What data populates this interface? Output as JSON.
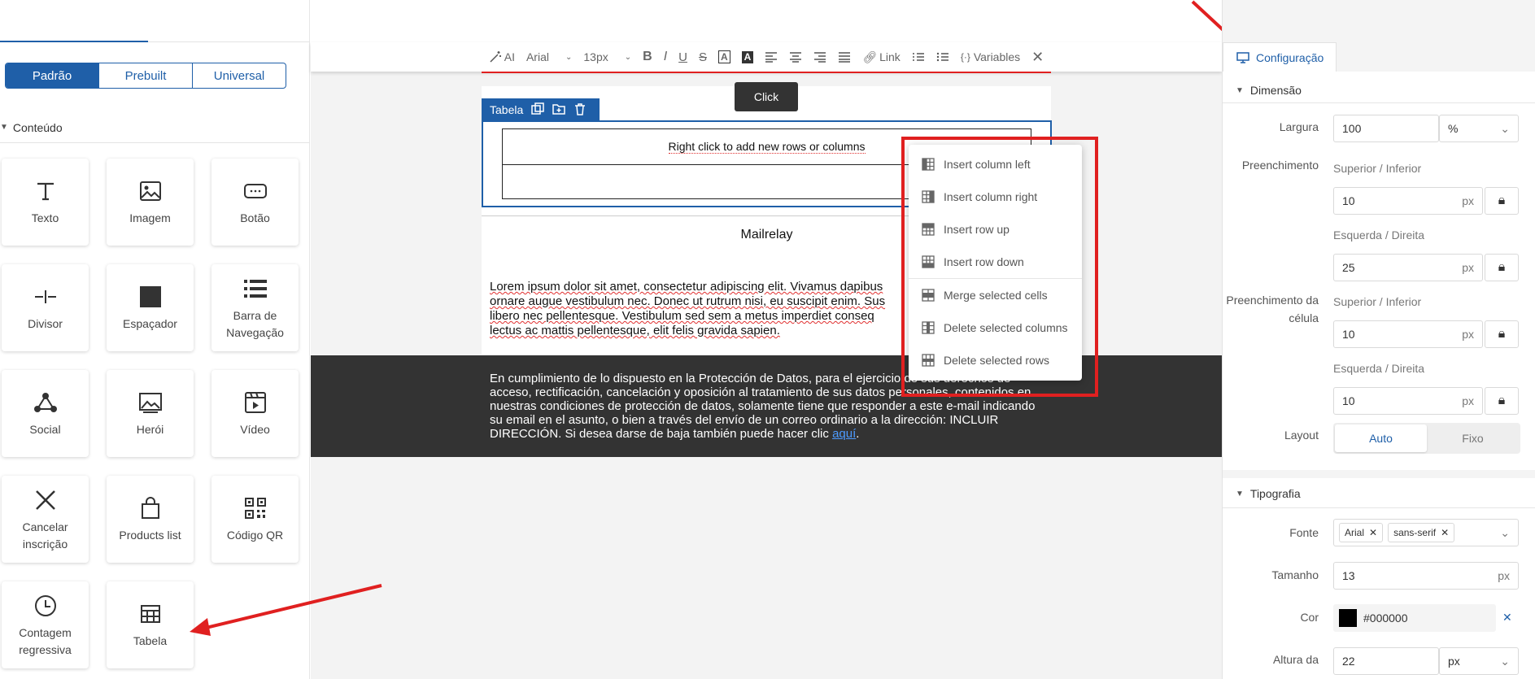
{
  "left": {
    "segments": [
      "Padrão",
      "Prebuilt",
      "Universal"
    ],
    "active_segment": "Padrão",
    "section_title": "Conteúdo",
    "blocks": [
      {
        "label": "Texto",
        "icon": "text-icon"
      },
      {
        "label": "Imagem",
        "icon": "image-icon"
      },
      {
        "label": "Botão",
        "icon": "button-icon"
      },
      {
        "label": "Divisor",
        "icon": "divider-icon"
      },
      {
        "label": "Espaçador",
        "icon": "spacer-icon"
      },
      {
        "label": "Barra de Navegação",
        "icon": "navbar-icon"
      },
      {
        "label": "Social",
        "icon": "social-icon"
      },
      {
        "label": "Herói",
        "icon": "hero-icon"
      },
      {
        "label": "Vídeo",
        "icon": "video-icon"
      },
      {
        "label": "Cancelar inscrição",
        "icon": "unsubscribe-icon"
      },
      {
        "label": "Products list",
        "icon": "shopping-bag-icon"
      },
      {
        "label": "Código QR",
        "icon": "qr-code-icon"
      },
      {
        "label": "Contagem regressiva",
        "icon": "clock-icon"
      },
      {
        "label": "Tabela",
        "icon": "table-icon"
      }
    ]
  },
  "toolbar": {
    "ai_label": "AI",
    "font": "Arial",
    "size": "13px",
    "link_label": "Link",
    "variables_label": "Variables"
  },
  "canvas": {
    "click_tip": "Click",
    "table_label": "Tabela",
    "table_hint": "Right click to add new rows or columns",
    "brand": "Mailrelay",
    "lorem_lines": [
      "Lorem ipsum dolor sit amet, consectetur adipiscing elit. Vivamus dapibus",
      "ornare augue vestibulum nec. Donec ut rutrum nisi, eu suscipit enim. Sus",
      "libero nec pellentesque. Vestibulum sed sem a metus imperdiet conseq",
      "lectus ac mattis pellentesque, elit felis gravida sapien."
    ],
    "legal_text": "En cumplimiento de lo dispuesto en la Protección de Datos, para el ejercicio de sus derechos de acceso, rectificación, cancelación y oposición al tratamiento de sus datos personales, contenidos en nuestras condiciones de protección de datos, solamente tiene que responder a este e-mail indicando su email en el asunto, o bien a través del envío de un correo ordinario a la dirección: INCLUIR DIRECCIÓN. Si desea darse de baja también puede hacer clic",
    "legal_link": "aquí",
    "legal_end": "."
  },
  "context_menu": {
    "items": [
      "Insert column left",
      "Insert column right",
      "Insert row up",
      "Insert row down",
      "Merge selected cells",
      "Delete selected columns",
      "Delete selected rows"
    ]
  },
  "right": {
    "tab_label": "Configuração",
    "dimension_title": "Dimensão",
    "largura_label": "Largura",
    "largura_value": "100",
    "largura_unit": "%",
    "preenchimento_label": "Preenchimento",
    "sup_inf": "Superior / Inferior",
    "esq_dir": "Esquerda / Direita",
    "pad_v": "10",
    "pad_h": "25",
    "cell_pad_label": "Preenchimento da célula",
    "cell_pad_v": "10",
    "cell_pad_h": "10",
    "px": "px",
    "layout_label": "Layout",
    "layout_options": [
      "Auto",
      "Fixo"
    ],
    "layout_active": "Auto",
    "typo_title": "Tipografia",
    "fonte_label": "Fonte",
    "font_chips": [
      "Arial",
      "sans-serif"
    ],
    "tamanho_label": "Tamanho",
    "tamanho_value": "13",
    "cor_label": "Cor",
    "cor_value": "#000000",
    "altura_label": "Altura da",
    "altura_value": "22",
    "altura_unit": "px"
  },
  "colors": {
    "accent": "#1f5fa8",
    "highlight_red": "#e02020",
    "footer_dark": "#333333"
  }
}
